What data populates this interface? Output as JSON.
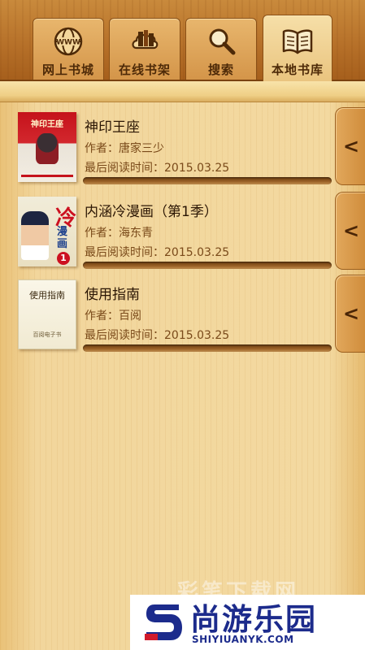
{
  "tabs": [
    {
      "label": "网上书城",
      "icon": "globe-www-icon",
      "active": false
    },
    {
      "label": "在线书架",
      "icon": "cloud-bookshelf-icon",
      "active": false
    },
    {
      "label": "搜索",
      "icon": "magnifier-icon",
      "active": false
    },
    {
      "label": "本地书库",
      "icon": "open-book-icon",
      "active": true
    }
  ],
  "books": [
    {
      "title": "神印王座",
      "author": "作者：唐家三少",
      "last_read": "最后阅读时间：2015.03.25",
      "progress": 0,
      "cover_text": "神印王座",
      "handle": "<"
    },
    {
      "title": "内涵冷漫画（第1季）",
      "author": "作者：海东青",
      "last_read": "最后阅读时间：2015.03.25",
      "progress": 0,
      "cover_text_top": "冷",
      "cover_text_side": "漫画",
      "cover_num": "1",
      "handle": "<"
    },
    {
      "title": "使用指南",
      "author": "作者：百阅",
      "last_read": "最后阅读时间：2015.03.25",
      "progress": 0,
      "cover_text": "使用指南",
      "cover_bottom": "百阅电子书",
      "handle": "<"
    }
  ],
  "watermark": {
    "faint": "彩笔下载网",
    "brand": "尚游乐园",
    "url": "SHIYIUANYK.COM"
  },
  "colors": {
    "wood_dark": "#a65f1c",
    "wood_light": "#f3d9a0",
    "text_dark": "#2b1604",
    "text_muted": "#7a4a1a",
    "watermark_blue": "#1c2b8c"
  }
}
